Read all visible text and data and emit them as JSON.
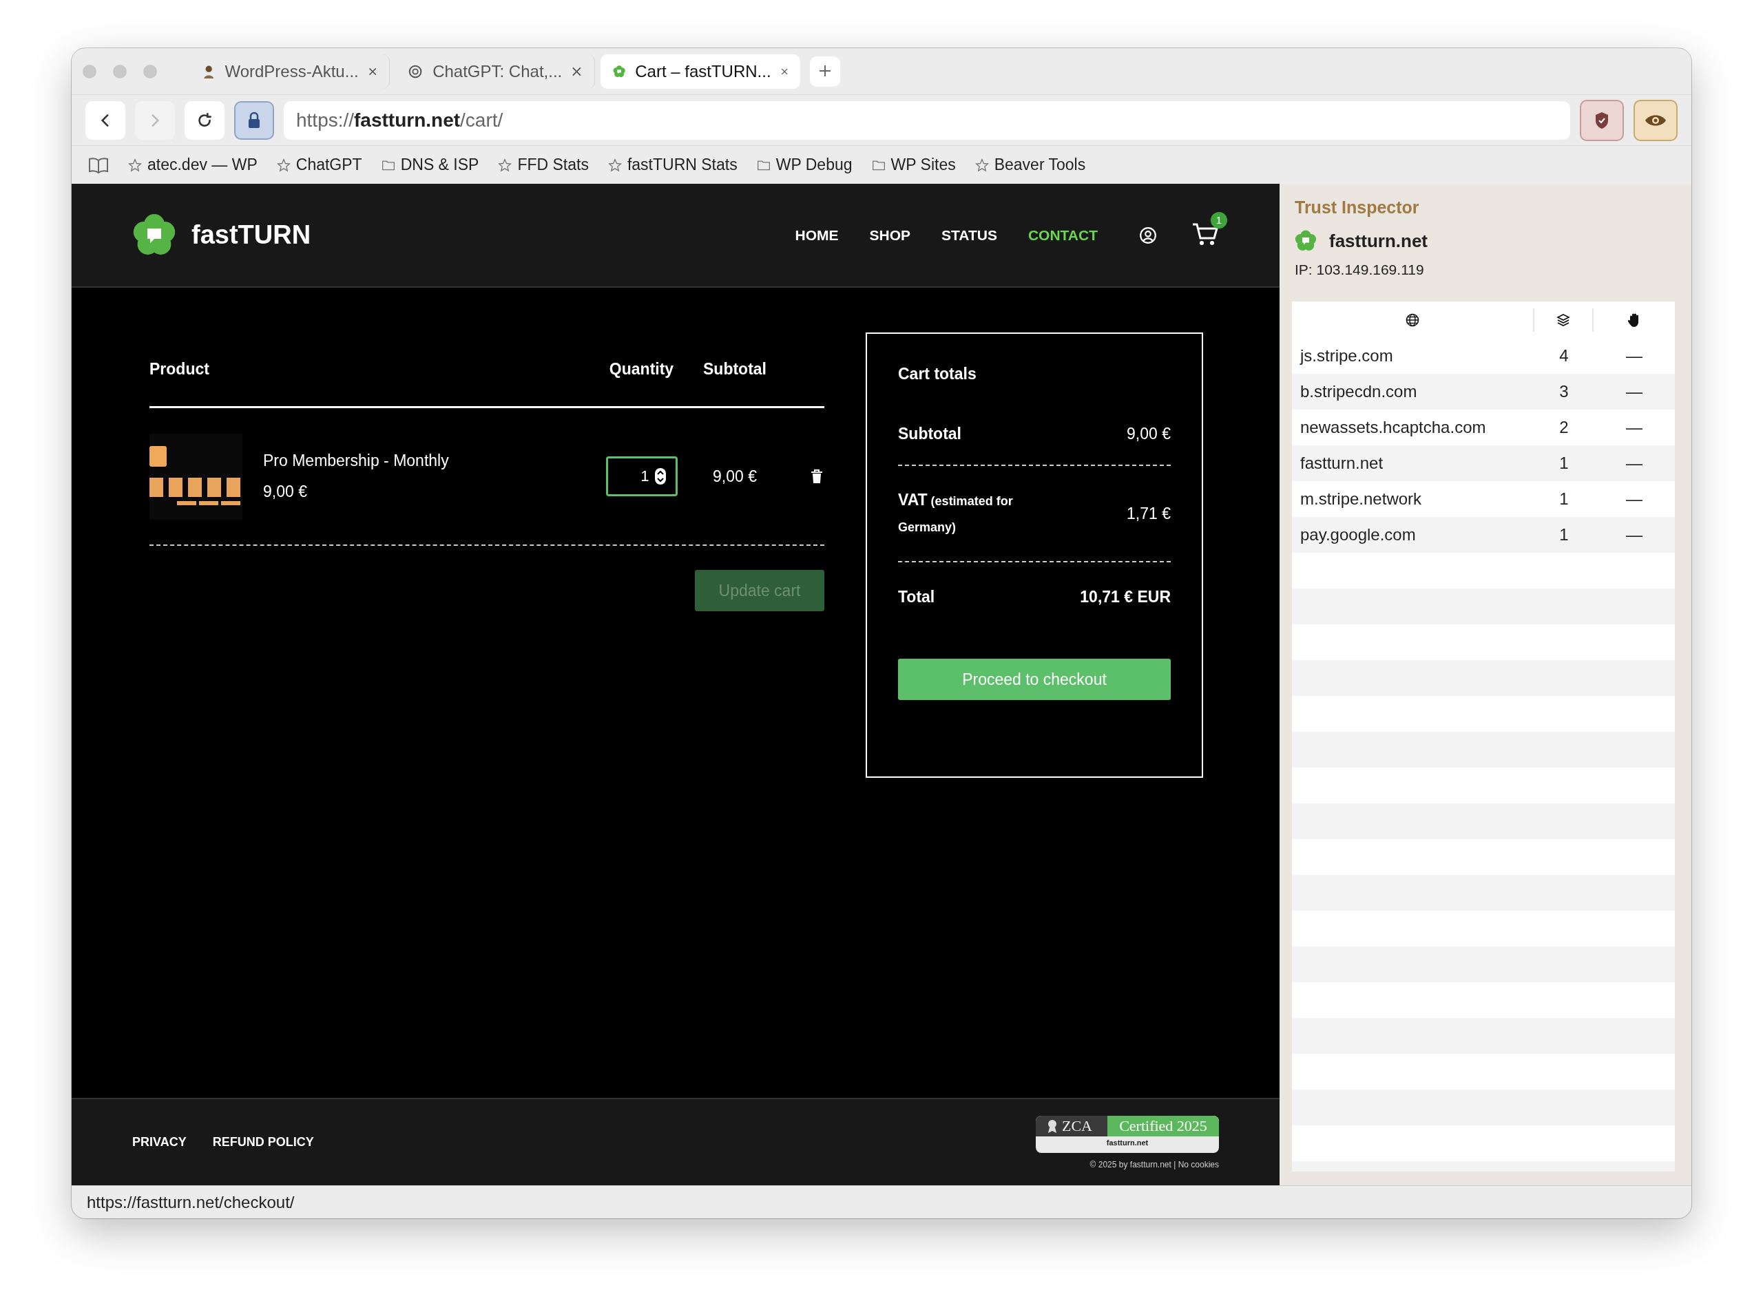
{
  "tabs": [
    {
      "title": "WordPress-Aktu...",
      "selected": false
    },
    {
      "title": "ChatGPT: Chat,...",
      "selected": false
    },
    {
      "title": "Cart – fastTURN...",
      "selected": true
    }
  ],
  "address_bar": {
    "url": "https://**fastturn.net**/cart/"
  },
  "bookmarks": [
    {
      "label": "atec.dev — WP",
      "kind": "star"
    },
    {
      "label": "ChatGPT",
      "kind": "star"
    },
    {
      "label": "DNS & ISP",
      "kind": "folder"
    },
    {
      "label": "FFD Stats",
      "kind": "star"
    },
    {
      "label": "fastTURN Stats",
      "kind": "star"
    },
    {
      "label": "WP Debug",
      "kind": "folder"
    },
    {
      "label": "WP Sites",
      "kind": "folder"
    },
    {
      "label": "Beaver Tools",
      "kind": "star"
    }
  ],
  "site": {
    "logo": "fastTURN",
    "nav": [
      {
        "label": "HOME",
        "selected": false
      },
      {
        "label": "SHOP",
        "selected": false
      },
      {
        "label": "STATUS",
        "selected": false
      },
      {
        "label": "CONTACT",
        "selected": true
      }
    ],
    "cart_count": "1"
  },
  "cart": {
    "columns": [
      "Product",
      "Quantity",
      "Subtotal"
    ],
    "items": [
      {
        "name": "Pro Membership - Monthly",
        "price": "9,00 €",
        "quantity": "1",
        "subtotal": "9,00 €"
      }
    ],
    "update_button": {
      "label": "Update cart",
      "disabled": true
    }
  },
  "totals": {
    "title": "Cart totals",
    "rows": [
      {
        "label": "Subtotal",
        "note": "",
        "value": "9,00 €"
      },
      {
        "label": "VAT",
        "note": "(estimated for Germany)",
        "value": "1,71 €"
      }
    ],
    "total": {
      "label": "Total",
      "value": "10,71 € EUR"
    },
    "checkout_button": "Proceed to checkout"
  },
  "footer": {
    "links": [
      "PRIVACY",
      "REFUND POLICY"
    ],
    "badge": {
      "left": "ZCA",
      "right": "Certified 2025",
      "domain": "fastturn.net"
    },
    "copyright": "© 2025 by fastturn.net | No cookies"
  },
  "status_bar": {
    "url": "https://fastturn.net/checkout/"
  },
  "trust_inspector": {
    "title": "Trust Inspector",
    "domain": "fastturn.net",
    "ip": "IP: 103.149.169.119",
    "rows": [
      {
        "host": "js.stripe.com",
        "count": "4",
        "blocked": "—"
      },
      {
        "host": "b.stripecdn.com",
        "count": "3",
        "blocked": "—"
      },
      {
        "host": "newassets.hcaptcha.com",
        "count": "2",
        "blocked": "—"
      },
      {
        "host": "fastturn.net",
        "count": "1",
        "blocked": "—"
      },
      {
        "host": "m.stripe.network",
        "count": "1",
        "blocked": "—"
      },
      {
        "host": "pay.google.com",
        "count": "1",
        "blocked": "—"
      }
    ]
  }
}
